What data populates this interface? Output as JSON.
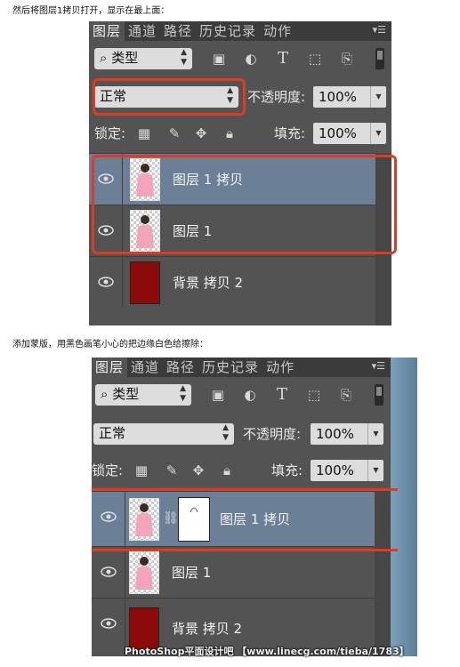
{
  "captions": {
    "top": "然后将图层1拷贝打开，显示在最上面：",
    "middle": "添加蒙版，用黑色画笔小心的把边缘白色给擦除："
  },
  "panel": {
    "tabs": [
      "图层",
      "通道",
      "路径",
      "历史记录",
      "动作"
    ],
    "menu_icon": "panel-menu-icon",
    "filter_label": "类型",
    "blend_mode": "正常",
    "opacity_label": "不透明度:",
    "opacity_value": "100%",
    "lock_label": "锁定:",
    "fill_label": "填充:",
    "fill_value": "100%",
    "filter_icons": [
      "image-filter-icon",
      "adjustment-filter-icon",
      "type-filter-icon",
      "shape-filter-icon",
      "smart-object-filter-icon"
    ],
    "lock_icons": [
      "lock-transparent-icon",
      "lock-paint-icon",
      "lock-position-icon",
      "lock-all-icon"
    ]
  },
  "screenshot1": {
    "layers": [
      {
        "name": "图层 1 拷贝",
        "selected": true,
        "thumb": "photo"
      },
      {
        "name": "图层 1",
        "selected": false,
        "thumb": "photo"
      },
      {
        "name": "背景 拷贝 2",
        "selected": false,
        "thumb": "solid"
      }
    ]
  },
  "screenshot2": {
    "layers": [
      {
        "name": "图层 1 拷贝",
        "selected": true,
        "thumb": "photo",
        "has_mask": true
      },
      {
        "name": "图层 1",
        "selected": false,
        "thumb": "photo"
      },
      {
        "name": "背景 拷贝 2",
        "selected": false,
        "thumb": "solid"
      }
    ]
  },
  "watermark": "PhotoShop平面设计吧 【www.linecg.com/tieba/1783】",
  "colors": {
    "highlight_red": "#e23a21",
    "selected_layer": "#6b7f96",
    "panel_bg": "#535353",
    "background_layer": "#8b0b0b"
  }
}
